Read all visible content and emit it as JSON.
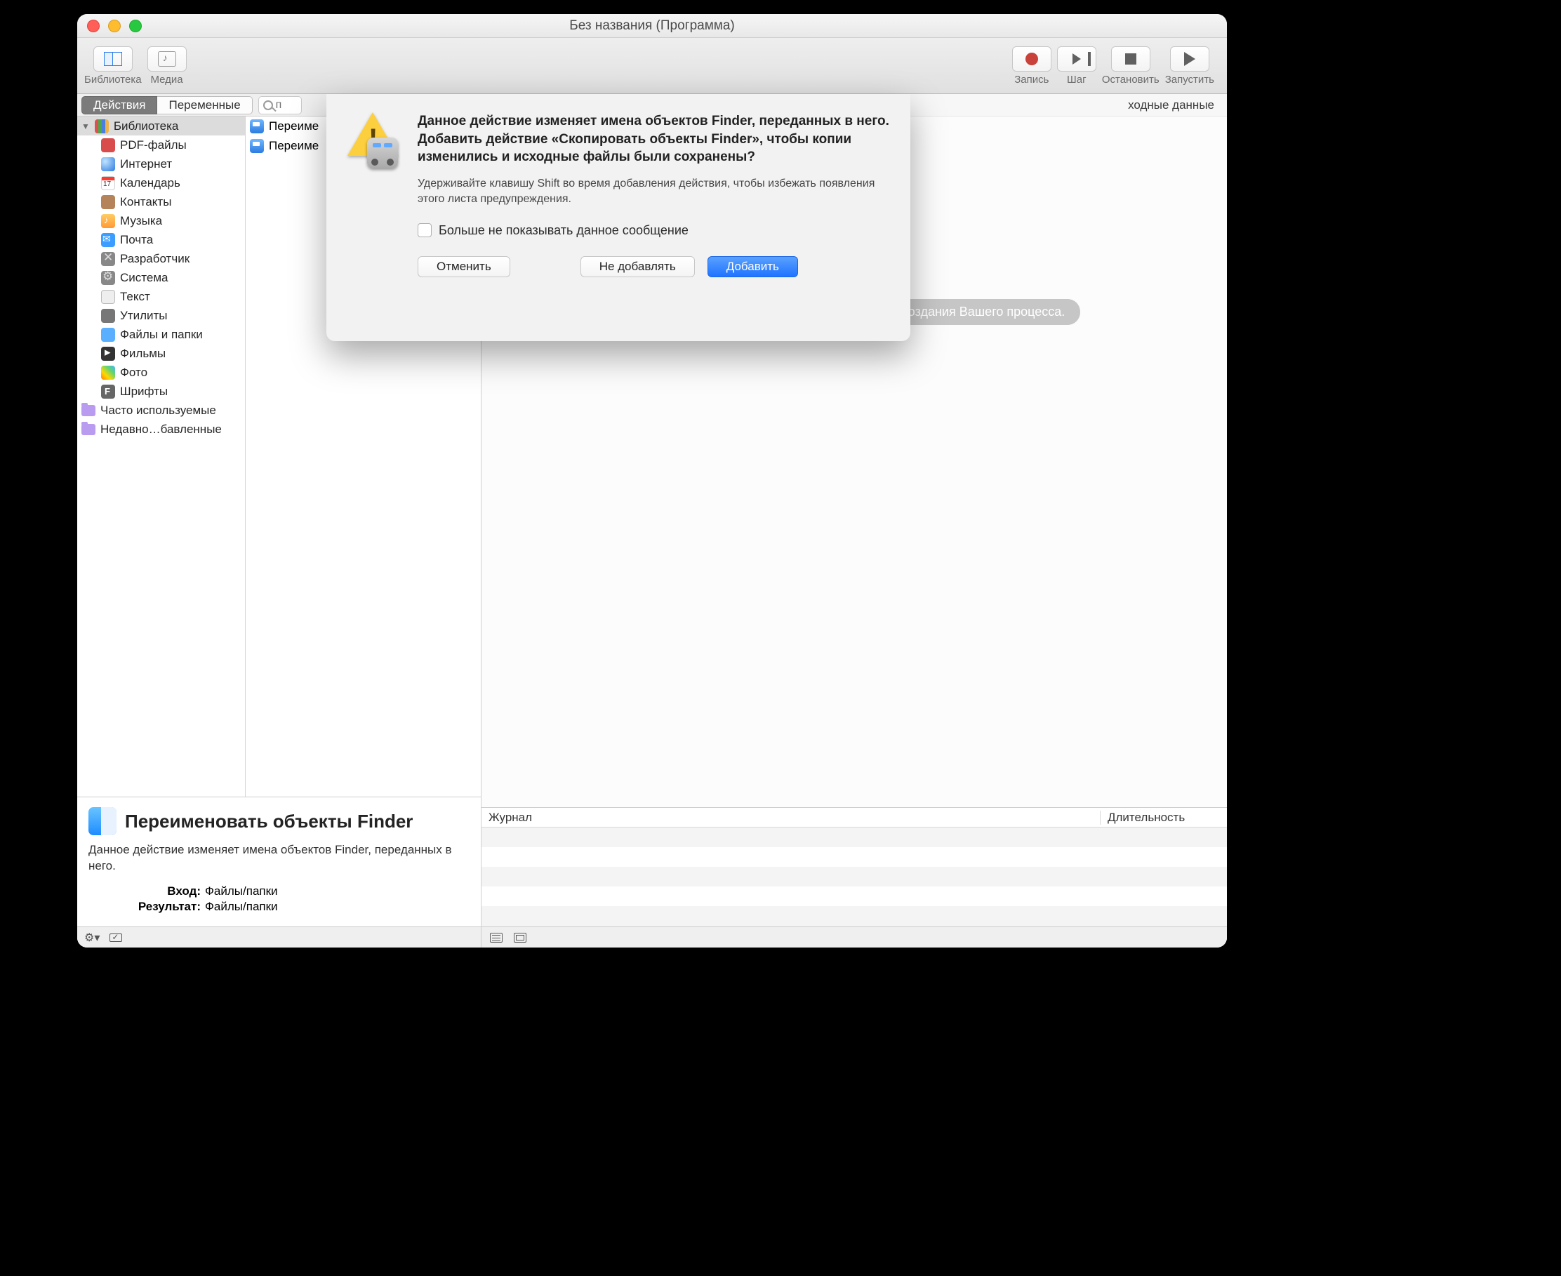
{
  "window": {
    "title": "Без названия (Программа)"
  },
  "toolbar": {
    "library": "Библиотека",
    "media": "Медиа",
    "record": "Запись",
    "step": "Шаг",
    "stop": "Остановить",
    "run": "Запустить"
  },
  "segmented": {
    "actions": "Действия",
    "variables": "Переменные"
  },
  "search": {
    "placeholder": "п"
  },
  "sidebar": {
    "rootLabel": "Библиотека",
    "categories": [
      {
        "label": "PDF-файлы"
      },
      {
        "label": "Интернет"
      },
      {
        "label": "Календарь"
      },
      {
        "label": "Контакты"
      },
      {
        "label": "Музыка"
      },
      {
        "label": "Почта"
      },
      {
        "label": "Разработчик"
      },
      {
        "label": "Система"
      },
      {
        "label": "Текст"
      },
      {
        "label": "Утилиты"
      },
      {
        "label": "Файлы и папки"
      },
      {
        "label": "Фильмы"
      },
      {
        "label": "Фото"
      },
      {
        "label": "Шрифты"
      }
    ],
    "smart": [
      {
        "label": "Часто используемые"
      },
      {
        "label": "Недавно…бавленные"
      }
    ]
  },
  "actionsList": [
    {
      "label": "Переиме"
    },
    {
      "label": "Переиме"
    }
  ],
  "workflow": {
    "receivesLabel": "ходные данные",
    "emptyHint": "Перетяните сюда действия или файлы для создания Вашего процесса."
  },
  "log": {
    "col1": "Журнал",
    "col2": "Длительность"
  },
  "info": {
    "title": "Переименовать объекты Finder",
    "desc": "Данное действие изменяет имена объектов Finder, переданных в него.",
    "inputLabel": "Вход:",
    "inputValue": "Файлы/папки",
    "resultLabel": "Результат:",
    "resultValue": "Файлы/папки"
  },
  "sheet": {
    "heading": "Данное действие изменяет имена объектов Finder, переданных в него. Добавить действие «Скопировать объекты Finder», чтобы копии изменились и исходные файлы были сохранены?",
    "sub": "Удерживайте клавишу Shift во время добавления действия, чтобы избежать появления этого листа предупреждения.",
    "checkbox": "Больше не показывать данное сообщение",
    "cancel": "Отменить",
    "dontAdd": "Не добавлять",
    "add": "Добавить"
  }
}
